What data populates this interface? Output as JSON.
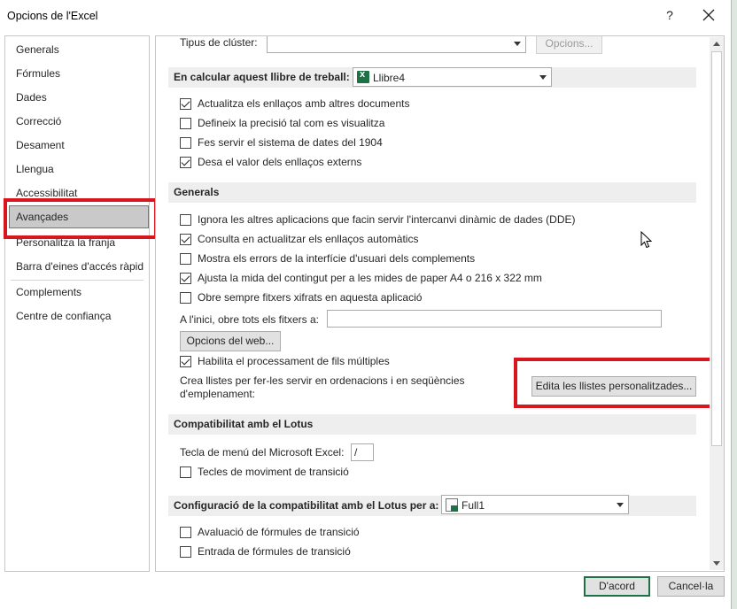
{
  "window": {
    "title": "Opcions de l'Excel",
    "help_label": "?"
  },
  "nav": {
    "items": [
      {
        "label": "Generals"
      },
      {
        "label": "Fórmules"
      },
      {
        "label": "Dades"
      },
      {
        "label": "Correcció"
      },
      {
        "label": "Desament"
      },
      {
        "label": "Llengua"
      },
      {
        "label": "Accessibilitat"
      },
      {
        "label": "Avançades"
      },
      {
        "label": "Personalitza la franja"
      },
      {
        "label": "Barra d'eines d'accés ràpid"
      },
      {
        "label": "Complements"
      },
      {
        "label": "Centre de confiança"
      }
    ],
    "selected": "Avançades"
  },
  "top_partial": {
    "cluster_label": "Tipus de clúster:",
    "cluster_value": "",
    "options_button": "Opcions..."
  },
  "workbook_section": {
    "header": "En calcular aquest llibre de treball:",
    "workbook_value": "Llibre4",
    "checkboxes": [
      {
        "label": "Actualitza els enllaços amb altres documents",
        "checked": true
      },
      {
        "label": "Defineix la precisió tal com es visualitza",
        "checked": false
      },
      {
        "label": "Fes servir el sistema de dates del 1904",
        "checked": false
      },
      {
        "label": "Desa el valor dels enllaços externs",
        "checked": true
      }
    ]
  },
  "general_section": {
    "header": "Generals",
    "checkboxes": [
      {
        "label": "Ignora les altres aplicacions que facin servir l'intercanvi dinàmic de dades (DDE)",
        "checked": false
      },
      {
        "label": "Consulta en actualitzar els enllaços automàtics",
        "checked": true
      },
      {
        "label": "Mostra els errors de la interfície d'usuari dels complements",
        "checked": false
      },
      {
        "label": "Ajusta la mida del contingut per a les mides de paper A4 o 216 x 322 mm",
        "checked": true
      },
      {
        "label": "Obre sempre fitxers xifrats en aquesta aplicació",
        "checked": false
      }
    ],
    "startup_label": "A l'inici, obre tots els fitxers a:",
    "startup_value": "",
    "web_options_button": "Opcions del web...",
    "multithread_label": "Habilita el processament de fils múltiples",
    "multithread_checked": true,
    "custom_lists_text_1": "Crea llistes per fer-les servir en ordenacions i en seqüències",
    "custom_lists_text_2": "d'emplenament:",
    "custom_lists_button": "Edita les llistes personalitzades..."
  },
  "lotus_section": {
    "header": "Compatibilitat amb el Lotus",
    "menu_key_label": "Tecla de menú del Microsoft Excel:",
    "menu_key_value": "/",
    "transition_nav_label": "Tecles de moviment de transició",
    "transition_nav_checked": false
  },
  "lotus_config_section": {
    "header": "Configuració de la compatibilitat amb el Lotus per a:",
    "sheet_value": "Full1",
    "checkboxes": [
      {
        "label": "Avaluació de fórmules de transició",
        "checked": false
      },
      {
        "label": "Entrada de fórmules de transició",
        "checked": false
      }
    ]
  },
  "footer": {
    "ok_label": "D'acord",
    "cancel_label": "Cancel·la"
  },
  "colors": {
    "highlight_red": "#d9151d",
    "excel_green": "#1e7145",
    "section_bg": "#eeeeee"
  }
}
